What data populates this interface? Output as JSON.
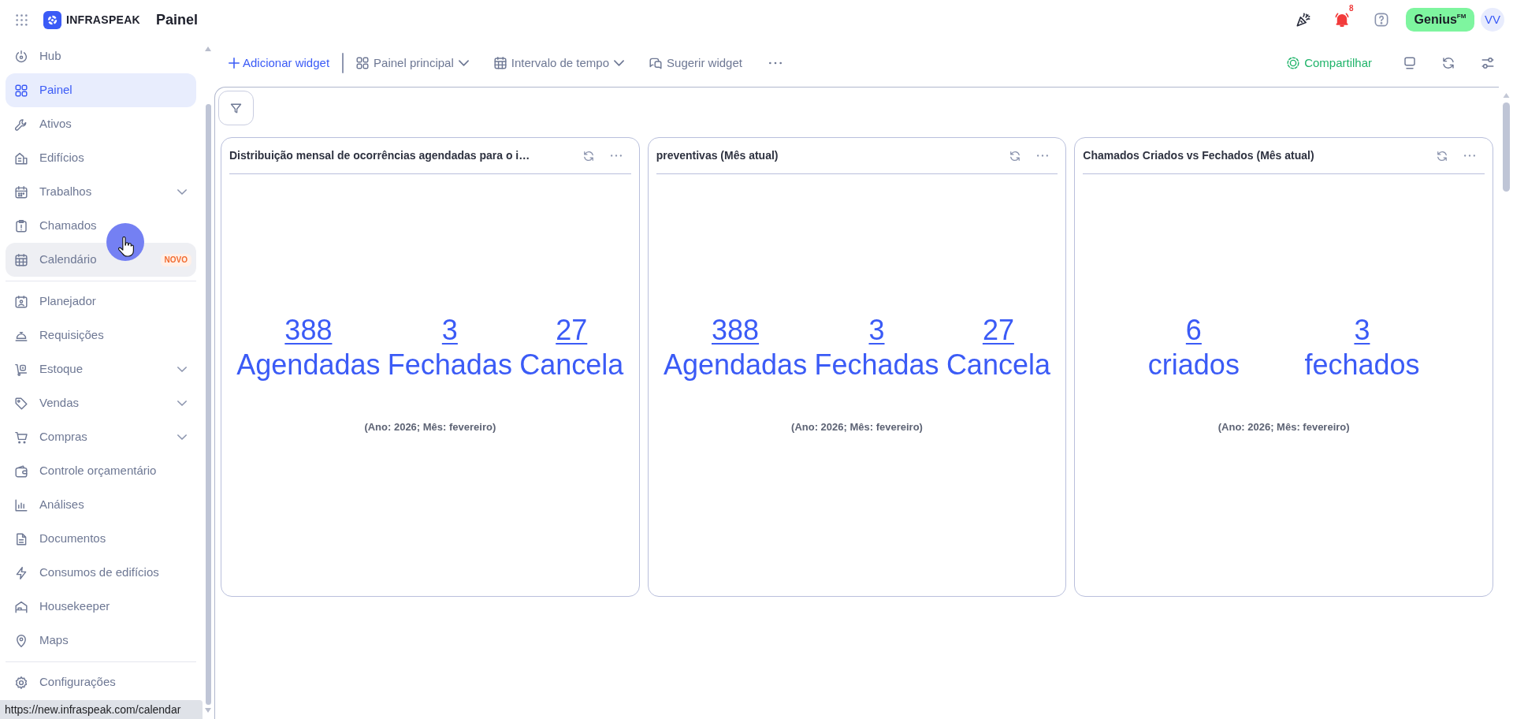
{
  "topbar": {
    "brand": "INFRASPEAK",
    "page_title": "Painel",
    "notification_count": "8",
    "plan_badge": "Genius$^{FM}$",
    "avatar_initials": "VV"
  },
  "sidebar": {
    "sections": [
      {
        "items": [
          {
            "label": "Hub",
            "selected": false,
            "hovered": false,
            "has_submenu": false
          },
          {
            "label": "Painel",
            "selected": true,
            "hovered": false,
            "has_submenu": false
          },
          {
            "label": "Ativos",
            "selected": false,
            "hovered": false,
            "has_submenu": false
          },
          {
            "label": "Edifícios",
            "selected": false,
            "hovered": false,
            "has_submenu": false
          },
          {
            "label": "Trabalhos",
            "selected": false,
            "hovered": false,
            "has_submenu": true
          },
          {
            "label": "Chamados",
            "selected": false,
            "hovered": false,
            "has_submenu": false
          },
          {
            "label": "Calendário",
            "selected": false,
            "hovered": true,
            "has_submenu": false,
            "badge": "NOVO"
          }
        ]
      },
      {
        "items": [
          {
            "label": "Planejador",
            "selected": false,
            "hovered": false,
            "has_submenu": false
          },
          {
            "label": "Requisições",
            "selected": false,
            "hovered": false,
            "has_submenu": false
          },
          {
            "label": "Estoque",
            "selected": false,
            "hovered": false,
            "has_submenu": true
          },
          {
            "label": "Vendas",
            "selected": false,
            "hovered": false,
            "has_submenu": true
          },
          {
            "label": "Compras",
            "selected": false,
            "hovered": false,
            "has_submenu": true
          },
          {
            "label": "Controle orçamentário",
            "selected": false,
            "hovered": false,
            "has_submenu": false
          },
          {
            "label": "Análises",
            "selected": false,
            "hovered": false,
            "has_submenu": false
          },
          {
            "label": "Documentos",
            "selected": false,
            "hovered": false,
            "has_submenu": false
          },
          {
            "label": "Consumos de edifícios",
            "selected": false,
            "hovered": false,
            "has_submenu": false
          },
          {
            "label": "Housekeeper",
            "selected": false,
            "hovered": false,
            "has_submenu": false
          },
          {
            "label": "Maps",
            "selected": false,
            "hovered": false,
            "has_submenu": false
          }
        ]
      },
      {
        "items": [
          {
            "label": "Configurações",
            "selected": false,
            "hovered": false,
            "has_submenu": false
          }
        ]
      }
    ]
  },
  "toolbar": {
    "add_widget": "Adicionar widget",
    "dashboard": "Painel principal",
    "time_range": "Intervalo de tempo",
    "suggest_widget": "Sugerir widget",
    "share": "Compartilhar"
  },
  "widgets": [
    {
      "title": "Distribuição mensal de ocorrências agendadas para o i…",
      "stats": [
        {
          "value": "388",
          "label": "Agendadas"
        },
        {
          "value": "3",
          "label": "Fechadas"
        },
        {
          "value": "27",
          "label": "Cancela"
        }
      ],
      "caption": "(Ano: 2026; Mês: fevereiro)"
    },
    {
      "title": "preventivas (Mês atual)",
      "stats": [
        {
          "value": "388",
          "label": "Agendadas"
        },
        {
          "value": "3",
          "label": "Fechadas"
        },
        {
          "value": "27",
          "label": "Cancela"
        }
      ],
      "caption": "(Ano: 2026; Mês: fevereiro)"
    },
    {
      "title": "Chamados Criados vs Fechados (Mês atual)",
      "stats": [
        {
          "value": "6",
          "label": "criados"
        },
        {
          "value": "3",
          "label": "fechados"
        }
      ],
      "caption": "(Ano: 2026; Mês: fevereiro)"
    }
  ],
  "link_preview": "https://new.infraspeak.com/calendar"
}
